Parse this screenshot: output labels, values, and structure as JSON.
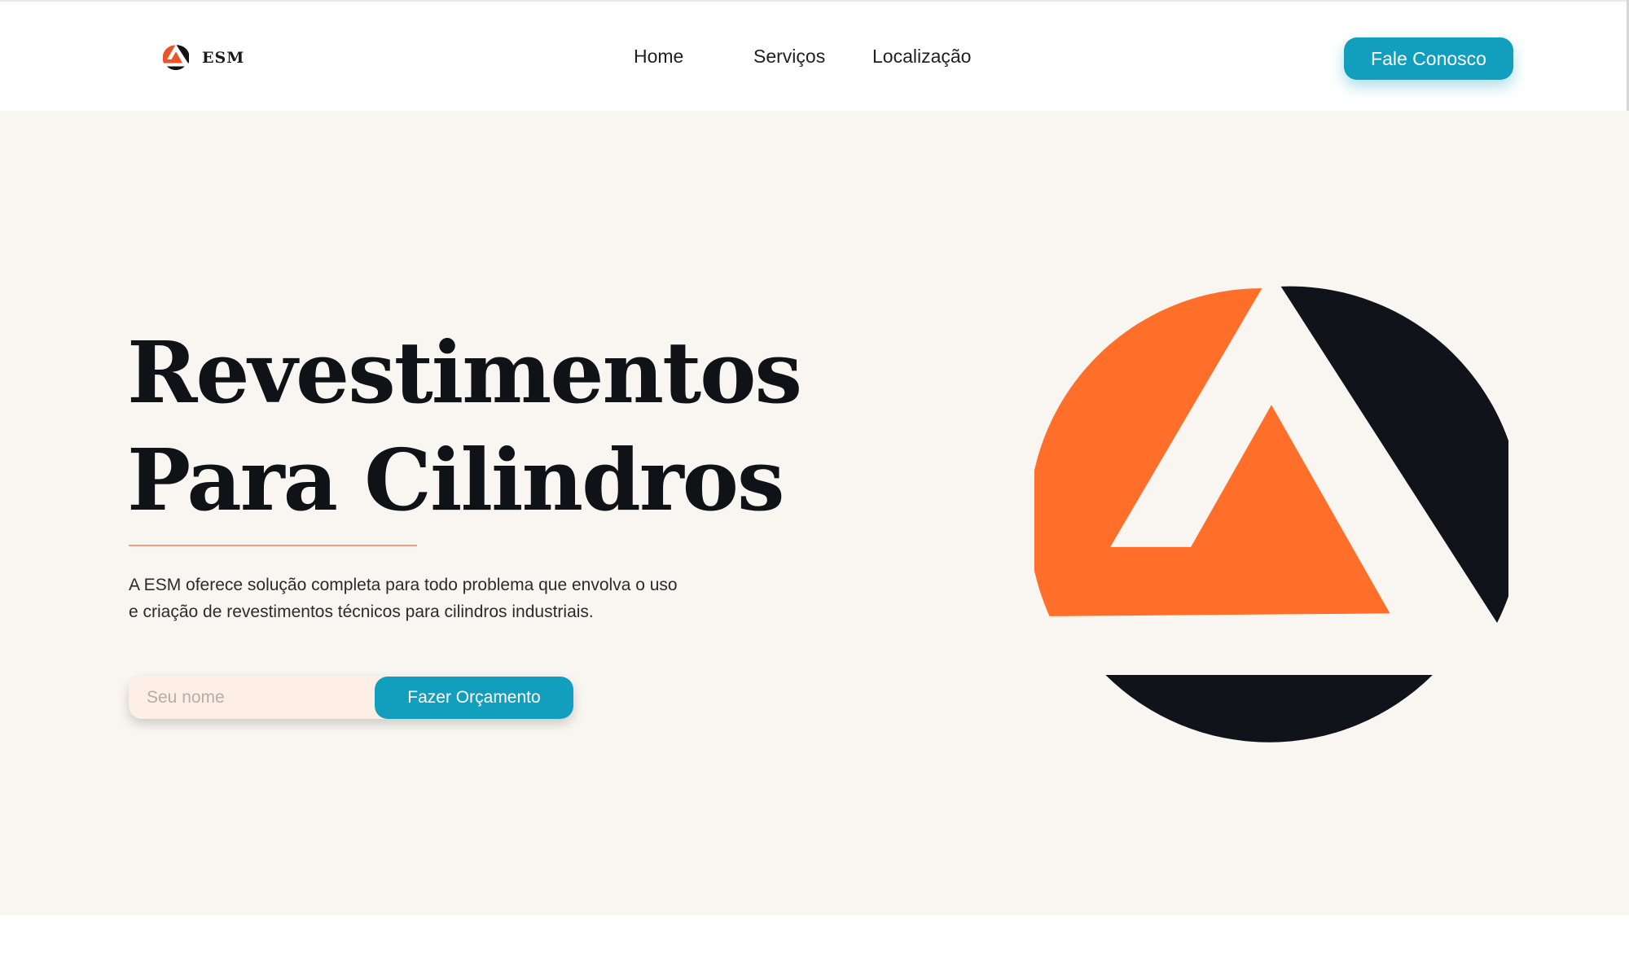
{
  "header": {
    "brand": {
      "name": "ESM",
      "logo_icon": "esm-triangle-logo-icon"
    },
    "nav": [
      {
        "label": "Home"
      },
      {
        "label": "Serviços"
      },
      {
        "label": "Localização"
      }
    ],
    "cta_label": "Fale Conosco"
  },
  "hero": {
    "title_line1": "Revestimentos",
    "title_line2": "Para Cilindros",
    "description": "A ESM oferece solução completa para todo problema que envolva o uso e criação de revestimentos técnicos para cilindros industriais.",
    "form": {
      "name_placeholder": "Seu nome",
      "name_value": "",
      "submit_label": "Fazer Orçamento"
    },
    "logo_icon": "esm-triangle-logo-icon"
  },
  "colors": {
    "accent": "#119fbd",
    "brand_orange": "#ff6f29",
    "brand_dark": "#11131a",
    "hero_background": "#f9f6f2",
    "divider": "#f0a07c",
    "input_background": "#fdeee6"
  }
}
